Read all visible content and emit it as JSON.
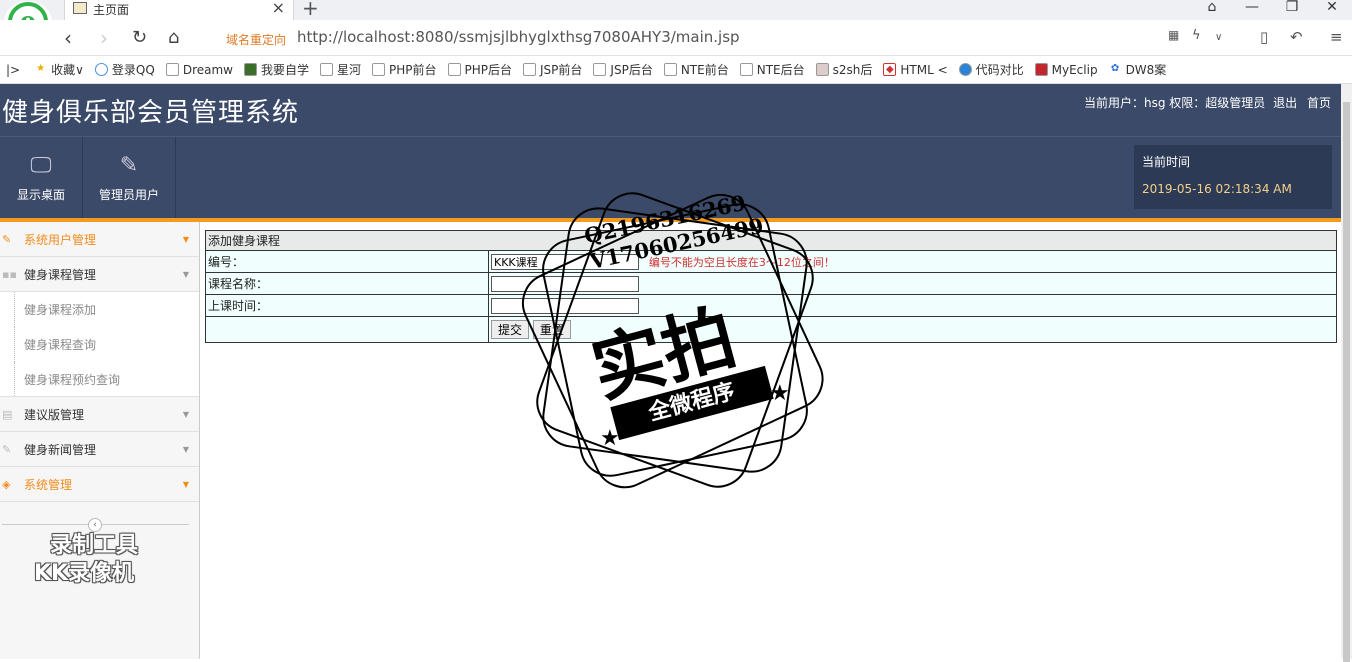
{
  "browser": {
    "tab_title": "主页面",
    "redirect_label": "域名重定向",
    "url": "http://localhost:8080/ssmjsjlbhyglxthsg7080AHY3/main.jsp",
    "bookmarks": [
      "收藏",
      "登录QQ",
      "Dreamw",
      "我要自学",
      "星河",
      "PHP前台",
      "PHP后台",
      "JSP前台",
      "JSP后台",
      "NTE前台",
      "NTE后台",
      "s2sh后",
      "HTML <",
      "代码对比",
      "MyEclip",
      "DW8案"
    ]
  },
  "header": {
    "title": "健身俱乐部会员管理系统",
    "user_info": "当前用户：hsg 权限：超级管理员",
    "logout": "退出",
    "home": "首页"
  },
  "toolbar": {
    "desktop": "显示桌面",
    "admin_users": "管理员用户",
    "clock_label": "当前时间",
    "clock_time": "2019-05-16 02:18:34 AM"
  },
  "sidebar": {
    "items": [
      {
        "label": "系统用户管理"
      },
      {
        "label": "健身课程管理"
      },
      {
        "label": "健身课程添加"
      },
      {
        "label": "健身课程查询"
      },
      {
        "label": "健身课程预约查询"
      },
      {
        "label": "建议版管理"
      },
      {
        "label": "健身新闻管理"
      },
      {
        "label": "系统管理"
      }
    ],
    "watermark_line1": "录制工具",
    "watermark_line2": "KK录像机"
  },
  "form": {
    "title": "添加健身课程",
    "fields": [
      {
        "label": "编号：",
        "value": "KKK课程",
        "error": "编号不能为空且长度在3～12位之间！"
      },
      {
        "label": "课程名称：",
        "value": ""
      },
      {
        "label": "上课时间：",
        "value": ""
      }
    ],
    "submit": "提交",
    "reset": "重置"
  },
  "stamp": {
    "line1": "Q2196316269",
    "line2": "V17060256499",
    "main": "实拍",
    "band": "全微程序"
  }
}
